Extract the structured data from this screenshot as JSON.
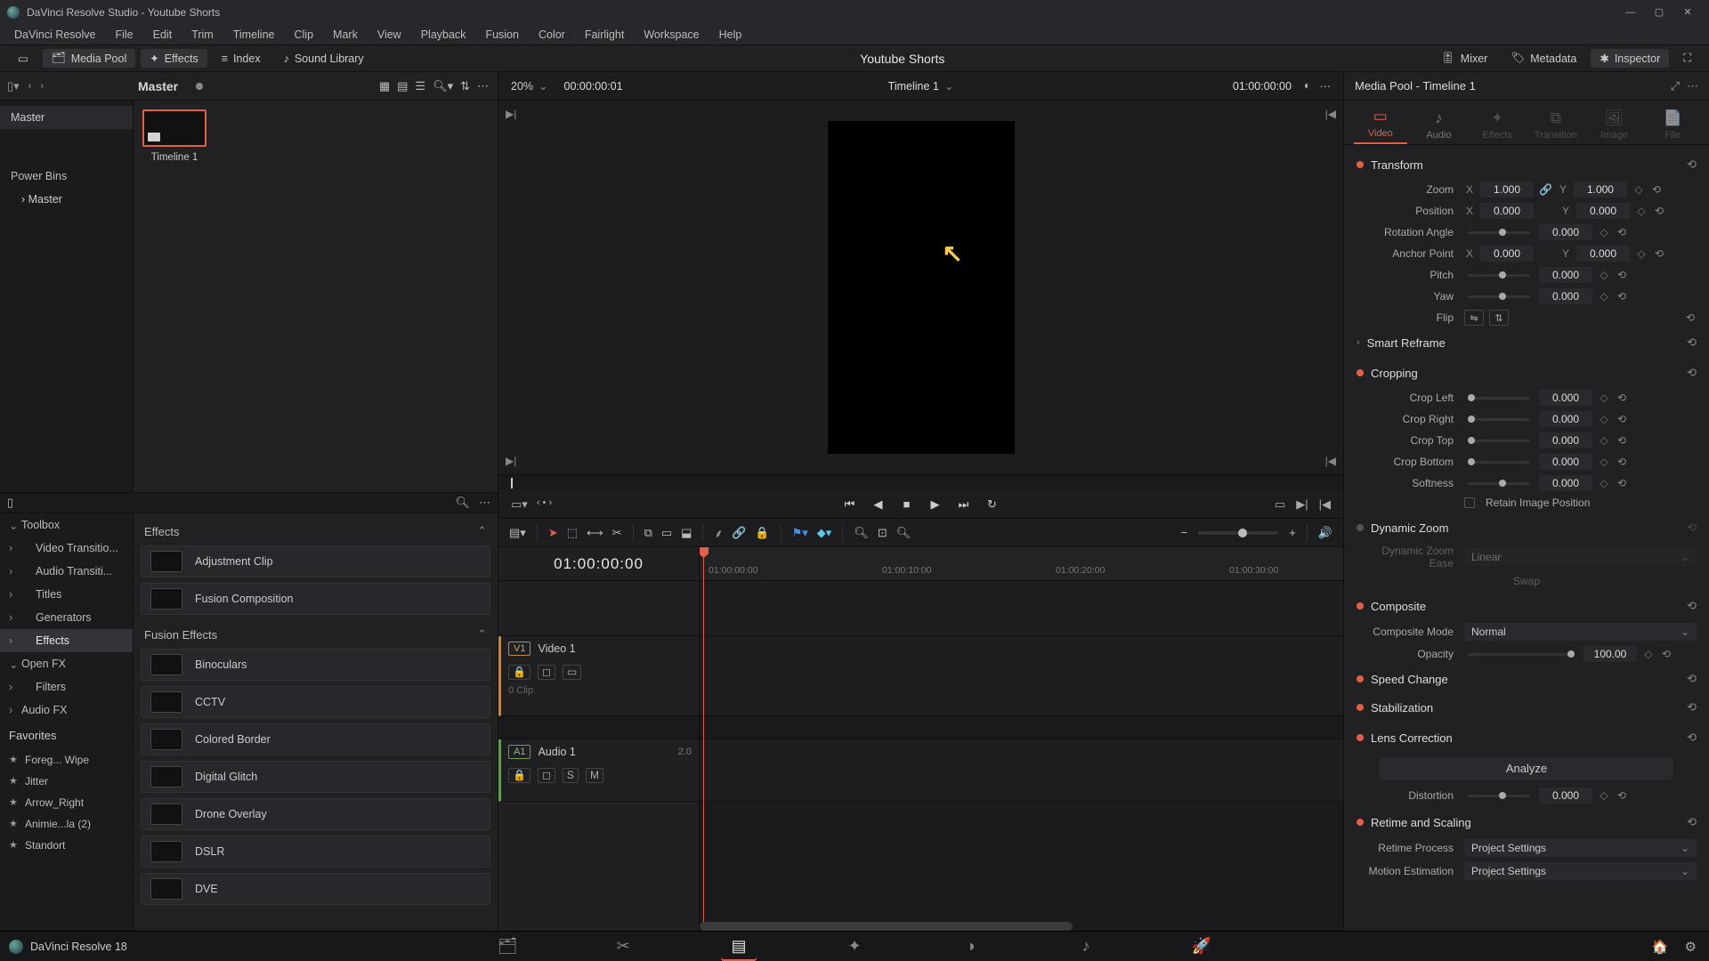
{
  "app": {
    "title": "DaVinci Resolve Studio - Youtube Shorts",
    "version_label": "DaVinci Resolve 18"
  },
  "menu": [
    "DaVinci Resolve",
    "File",
    "Edit",
    "Trim",
    "Timeline",
    "Clip",
    "Mark",
    "View",
    "Playback",
    "Fusion",
    "Color",
    "Fairlight",
    "Workspace",
    "Help"
  ],
  "wsrow": {
    "mediaPool": "Media Pool",
    "effects": "Effects",
    "index": "Index",
    "soundLib": "Sound Library",
    "mixer": "Mixer",
    "metadata": "Metadata",
    "inspector": "Inspector",
    "projectTitle": "Youtube Shorts"
  },
  "mediaPool": {
    "binHeader": "Master",
    "tree": {
      "master": "Master",
      "powerBins": "Power Bins",
      "pbMaster": "Master"
    },
    "clip1": "Timeline 1"
  },
  "fxLib": {
    "tree": {
      "toolbox": "Toolbox",
      "videoTrans": "Video Transitio...",
      "audioTrans": "Audio Transiti...",
      "titles": "Titles",
      "generators": "Generators",
      "effects": "Effects",
      "openfx": "Open FX",
      "filters": "Filters",
      "audiofx": "Audio FX",
      "favorites": "Favorites",
      "favs": [
        "Foreg... Wipe",
        "Jitter",
        "Arrow_Right",
        "Animie...la (2)",
        "Standort"
      ]
    },
    "sections": {
      "effects": "Effects",
      "fusion": "Fusion Effects"
    },
    "effectsItems": [
      "Adjustment Clip",
      "Fusion Composition"
    ],
    "fusionItems": [
      "Binoculars",
      "CCTV",
      "Colored Border",
      "Digital Glitch",
      "Drone Overlay",
      "DSLR",
      "DVE"
    ]
  },
  "viewer": {
    "zoom": "20%",
    "tcLeft": "00:00:00:01",
    "timelineName": "Timeline 1",
    "tcRight": "01:00:00:00"
  },
  "timeline": {
    "bigTc": "01:00:00:00",
    "ticks": [
      "01:00:00:00",
      "01:00:10:00",
      "01:00:20:00",
      "01:00:30:00"
    ],
    "video": {
      "tag": "V1",
      "name": "Video 1",
      "clipcount": "0 Clip"
    },
    "audio": {
      "tag": "A1",
      "name": "Audio 1",
      "meta": "2.0",
      "S": "S",
      "M": "M"
    }
  },
  "inspector": {
    "header": "Media Pool - Timeline 1",
    "tabs": {
      "video": "Video",
      "audio": "Audio",
      "effects": "Effects",
      "transition": "Transition",
      "image": "Image",
      "file": "File"
    },
    "transform": {
      "title": "Transform",
      "zoom": "Zoom",
      "zx": "1.000",
      "zy": "1.000",
      "position": "Position",
      "px": "0.000",
      "py": "0.000",
      "rotation": "Rotation Angle",
      "rv": "0.000",
      "anchor": "Anchor Point",
      "ax": "0.000",
      "ay": "0.000",
      "pitch": "Pitch",
      "pitchv": "0.000",
      "yaw": "Yaw",
      "yawv": "0.000",
      "flip": "Flip"
    },
    "smartReframe": "Smart Reframe",
    "cropping": {
      "title": "Cropping",
      "left": "Crop Left",
      "leftv": "0.000",
      "right": "Crop Right",
      "rightv": "0.000",
      "top": "Crop Top",
      "topv": "0.000",
      "bottom": "Crop Bottom",
      "bottomv": "0.000",
      "soft": "Softness",
      "softv": "0.000",
      "retain": "Retain Image Position"
    },
    "dynzoom": {
      "title": "Dynamic Zoom",
      "ease": "Dynamic Zoom Ease",
      "easev": "Linear",
      "swap": "Swap"
    },
    "composite": {
      "title": "Composite",
      "mode": "Composite Mode",
      "modev": "Normal",
      "opacity": "Opacity",
      "opv": "100.00"
    },
    "speed": {
      "title": "Speed Change"
    },
    "stab": {
      "title": "Stabilization"
    },
    "lens": {
      "title": "Lens Correction",
      "analyze": "Analyze",
      "dist": "Distortion",
      "distv": "0.000"
    },
    "retime": {
      "title": "Retime and Scaling",
      "proc": "Retime Process",
      "procv": "Project Settings",
      "motion": "Motion Estimation",
      "motionv": "Project Settings"
    }
  }
}
